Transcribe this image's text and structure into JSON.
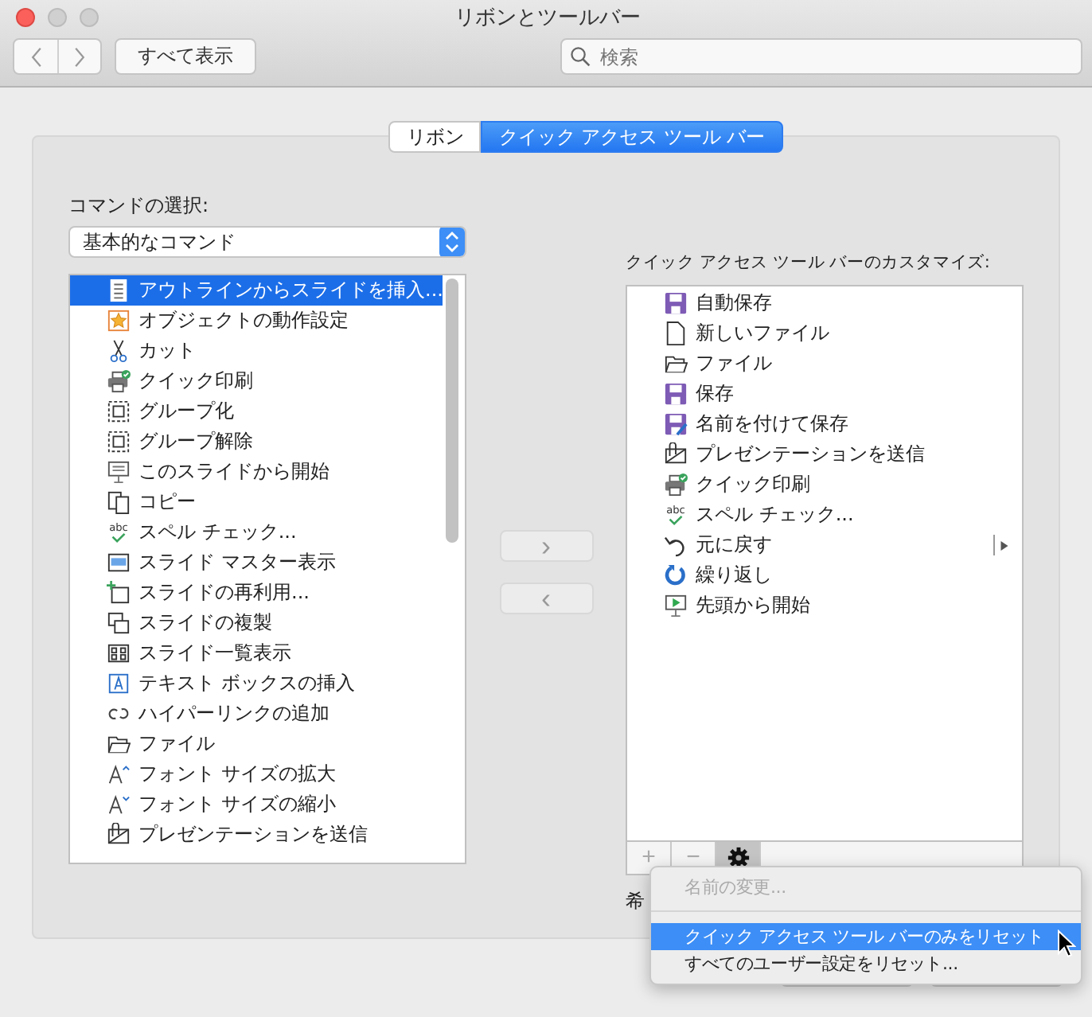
{
  "window": {
    "title": "リボンとツールバー"
  },
  "toolbar": {
    "show_all": "すべて表示",
    "search": {
      "placeholder": "検索"
    }
  },
  "tabs": [
    {
      "label": "リボン",
      "selected": false
    },
    {
      "label": "クイック アクセス ツール バー",
      "selected": true
    }
  ],
  "commands": {
    "label": "コマンドの選択:",
    "dropdown": "基本的なコマンド",
    "items": [
      {
        "label": "アウトラインからスライドを挿入...",
        "kind": "outline",
        "selected": true
      },
      {
        "label": "オブジェクトの動作設定",
        "kind": "star",
        "selected": false
      },
      {
        "label": "カット",
        "kind": "scissors",
        "selected": false
      },
      {
        "label": "クイック印刷",
        "kind": "printer",
        "selected": false
      },
      {
        "label": "グループ化",
        "kind": "group",
        "selected": false
      },
      {
        "label": "グループ解除",
        "kind": "ungroup",
        "selected": false
      },
      {
        "label": "このスライドから開始",
        "kind": "screen",
        "selected": false
      },
      {
        "label": "コピー",
        "kind": "copy",
        "selected": false
      },
      {
        "label": "スペル チェック...",
        "kind": "abc",
        "selected": false
      },
      {
        "label": "スライド マスター表示",
        "kind": "master",
        "selected": false
      },
      {
        "label": "スライドの再利用...",
        "kind": "reuse",
        "selected": false
      },
      {
        "label": "スライドの複製",
        "kind": "duplicate",
        "selected": false
      },
      {
        "label": "スライド一覧表示",
        "kind": "sorter",
        "selected": false
      },
      {
        "label": "テキスト ボックスの挿入",
        "kind": "textbox",
        "selected": false
      },
      {
        "label": "ハイパーリンクの追加",
        "kind": "link",
        "selected": false
      },
      {
        "label": "ファイル",
        "kind": "folder",
        "selected": false
      },
      {
        "label": "フォント サイズの拡大",
        "kind": "fontup",
        "selected": false
      },
      {
        "label": "フォント サイズの縮小",
        "kind": "fontdown",
        "selected": false
      },
      {
        "label": "プレゼンテーションを送信",
        "kind": "send",
        "selected": false
      }
    ]
  },
  "move_buttons": [
    {
      "label": "›",
      "disabled": true
    },
    {
      "label": "‹",
      "disabled": true
    }
  ],
  "quick_access": {
    "label": "クイック アクセス ツール バーのカスタマイズ:",
    "items": [
      {
        "label": "自動保存",
        "kind": "save",
        "split": false
      },
      {
        "label": "新しいファイル",
        "kind": "newfile",
        "split": false
      },
      {
        "label": "ファイル",
        "kind": "folder",
        "split": false
      },
      {
        "label": "保存",
        "kind": "save",
        "split": false
      },
      {
        "label": "名前を付けて保存",
        "kind": "saveas",
        "split": false
      },
      {
        "label": "プレゼンテーションを送信",
        "kind": "send",
        "split": false
      },
      {
        "label": "クイック印刷",
        "kind": "printer",
        "split": false
      },
      {
        "label": "スペル チェック...",
        "kind": "abc",
        "split": false
      },
      {
        "label": "元に戻す",
        "kind": "undo",
        "split": true
      },
      {
        "label": "繰り返し",
        "kind": "redo",
        "split": false
      },
      {
        "label": "先頭から開始",
        "kind": "play",
        "split": false
      }
    ],
    "add": "+",
    "remove": "−"
  },
  "partial_label": "希",
  "context_menu": [
    {
      "label": "名前の変更...",
      "disabled": true,
      "selected": false,
      "separator_after": true
    },
    {
      "label": "クイック アクセス ツール バーのみをリセット",
      "disabled": false,
      "selected": true,
      "separator_after": false
    },
    {
      "label": "すべてのユーザー設定をリセット...",
      "disabled": false,
      "selected": false,
      "separator_after": false
    }
  ]
}
